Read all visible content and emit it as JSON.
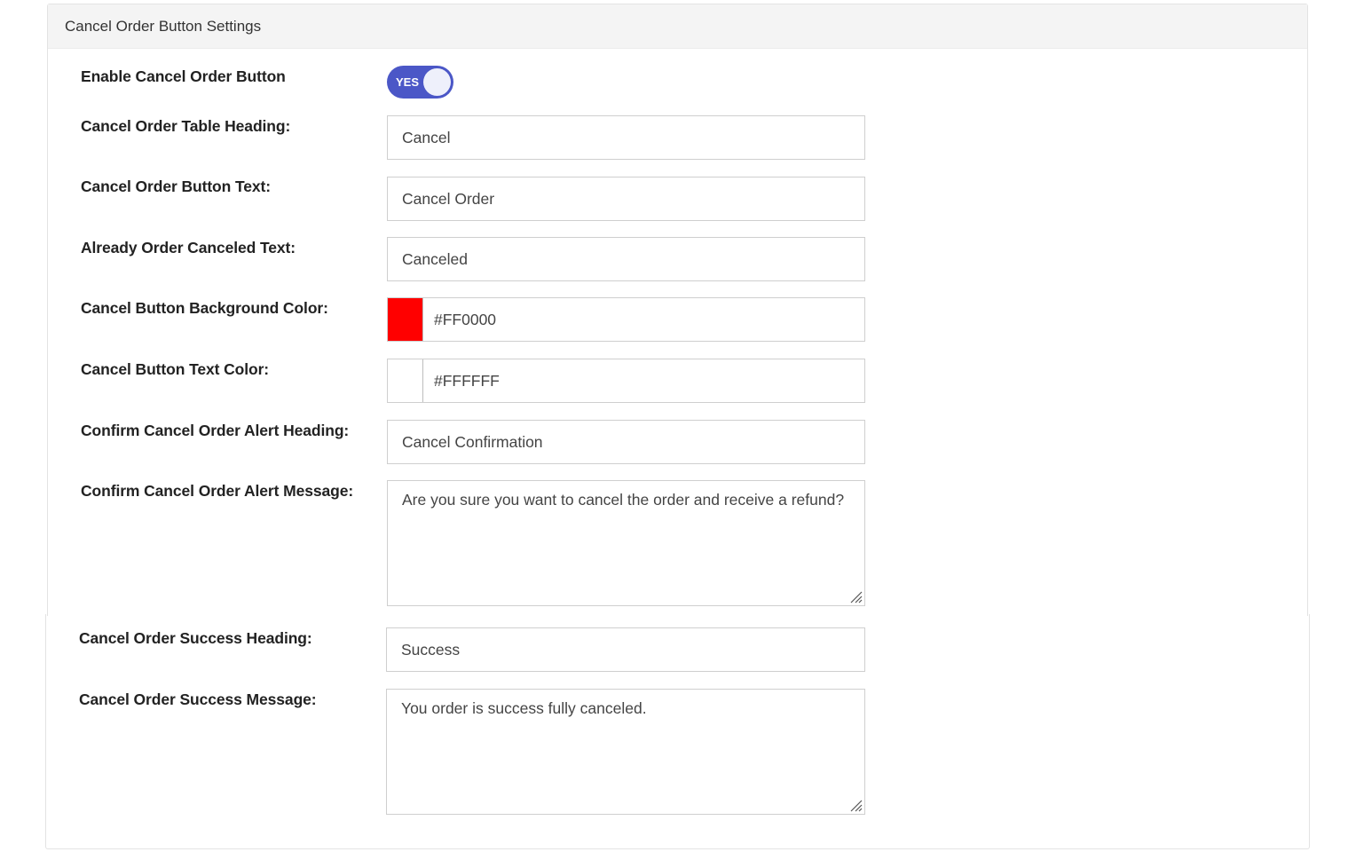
{
  "panel": {
    "title": "Cancel Order Button Settings"
  },
  "settings": {
    "enable": {
      "label": "Enable Cancel Order Button",
      "toggle_text": "YES",
      "value": true
    },
    "table_heading": {
      "label": "Cancel Order Table Heading:",
      "value": "Cancel"
    },
    "button_text": {
      "label": "Cancel Order Button Text:",
      "value": "Cancel Order"
    },
    "already_canceled": {
      "label": "Already Order Canceled Text:",
      "value": "Canceled"
    },
    "bg_color": {
      "label": "Cancel Button Background Color:",
      "value": "#FF0000",
      "swatch": "#FF0000"
    },
    "text_color": {
      "label": "Cancel Button Text Color:",
      "value": "#FFFFFF",
      "swatch": "#FFFFFF"
    },
    "alert_heading": {
      "label": "Confirm Cancel Order Alert Heading:",
      "value": "Cancel Confirmation"
    },
    "alert_message": {
      "label": "Confirm Cancel Order Alert Message:",
      "value": "Are you sure you want to cancel the order and receive a refund?"
    },
    "success_heading": {
      "label": "Cancel Order Success Heading:",
      "value": "Success"
    },
    "success_message": {
      "label": "Cancel Order Success Message:",
      "value": "You order is success fully canceled."
    }
  },
  "colors": {
    "toggle_on": "#4b57c7",
    "header_bg": "#f4f4f4"
  }
}
